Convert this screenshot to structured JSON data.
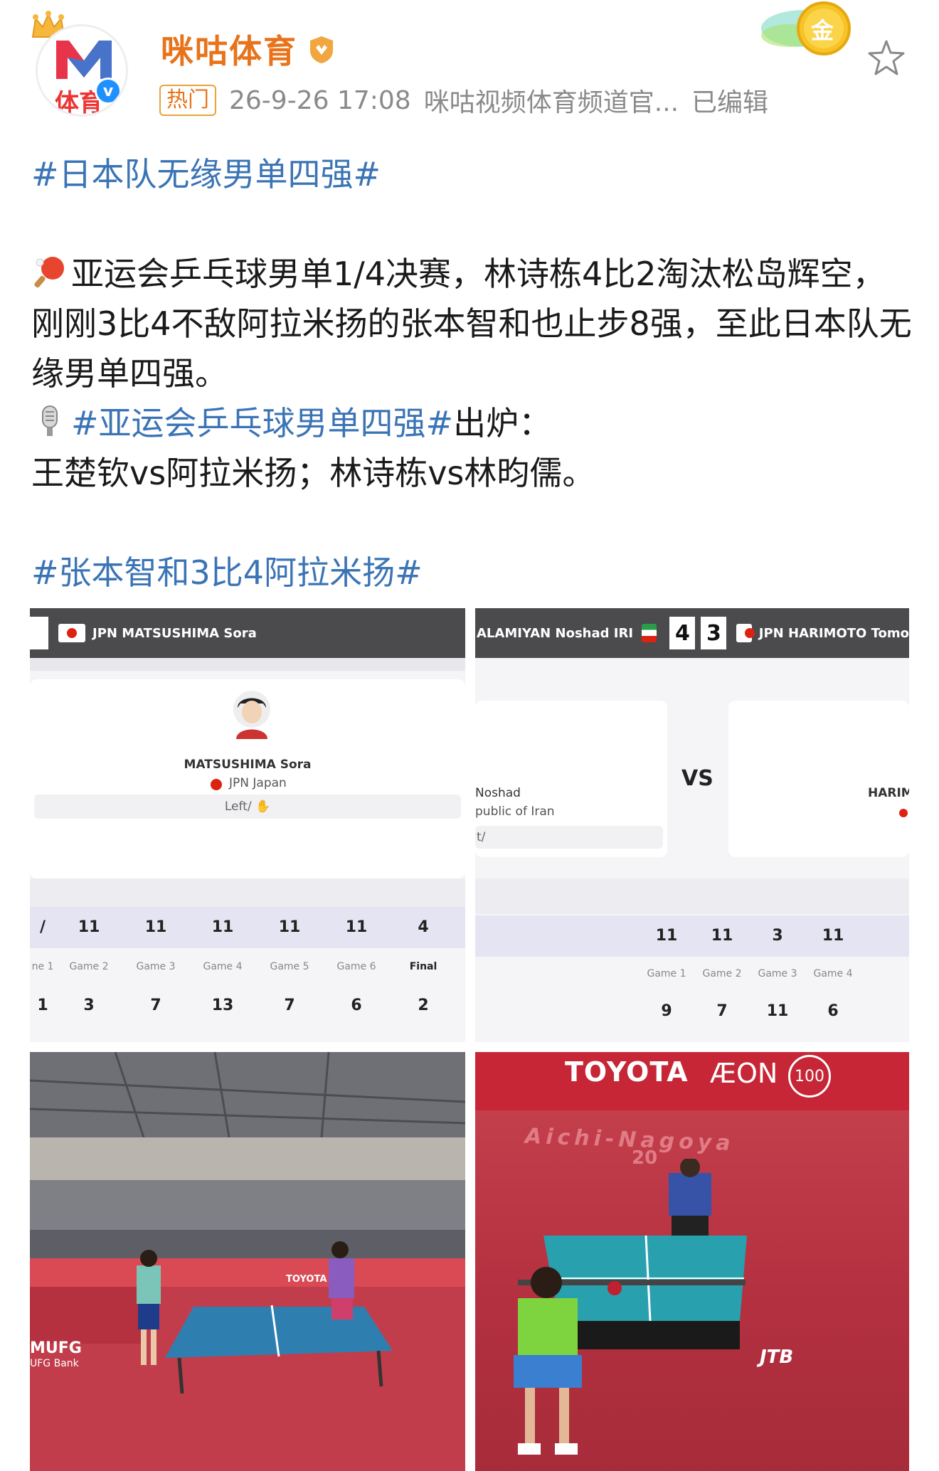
{
  "post": {
    "author": "咪咕体育",
    "hot_tag": "热门",
    "time": "26-9-26 17:08",
    "source": "咪咕视频体育频道官...",
    "edited": "已编辑",
    "avatar_text": "体育",
    "verified_mark": "v",
    "medal_text": "金"
  },
  "content": {
    "topic1": "#日本队无缘男单四强#",
    "para1": "亚运会乒乓球男单1/4决赛，林诗栋4比2淘汰松岛辉空，刚刚3比4不敌阿拉米扬的张本智和也止步8强，至此日本队无缘男单四强。",
    "topic2": "#亚运会乒乓球男单四强#",
    "topic2_suffix": "出炉：",
    "para2": "王楚钦vs阿拉米扬；林诗栋vs林昀儒。",
    "topic3": "#张本智和3比4阿拉米扬#"
  },
  "images": {
    "img1": {
      "top_player": "JPN MATSUSHIMA Sora",
      "card_name": "MATSUSHIMA Sora",
      "card_country": "JPN Japan",
      "card_hand": "Left/ ✋",
      "scores_top": [
        "11",
        "11",
        "11",
        "11",
        "11",
        "4"
      ],
      "labels": [
        "ne 1",
        "Game 2",
        "Game 3",
        "Game 4",
        "Game 5",
        "Game 6",
        "Final"
      ],
      "scores_bottom": [
        "1",
        "3",
        "7",
        "13",
        "7",
        "6",
        "2"
      ],
      "first_top": "/"
    },
    "img2": {
      "left_player": "ALAMIYAN Noshad IRI",
      "score_left": "4",
      "score_right": "3",
      "right_player": "JPN HARIMOTO Tomo",
      "card_left_name": "Noshad",
      "card_left_country": "public of Iran",
      "card_left_hand": "t/",
      "vs": "VS",
      "card_right_name": "HARIM",
      "scores_top": [
        "11",
        "11",
        "3",
        "11"
      ],
      "labels": [
        "Game 1",
        "Game 2",
        "Game 3",
        "Game 4"
      ],
      "scores_bottom": [
        "9",
        "7",
        "11",
        "6"
      ]
    },
    "img4": {
      "sponsor1": "TOYOTA",
      "sponsor2": "ÆON",
      "sponsor2_badge": "100",
      "floor_text": "Aichi-Nagoya",
      "floor_year": "20",
      "jtb": "JTB"
    },
    "img3": {
      "banner": "MUFG",
      "banner_sub": "UFG Bank",
      "board": "TOYOTA"
    }
  }
}
